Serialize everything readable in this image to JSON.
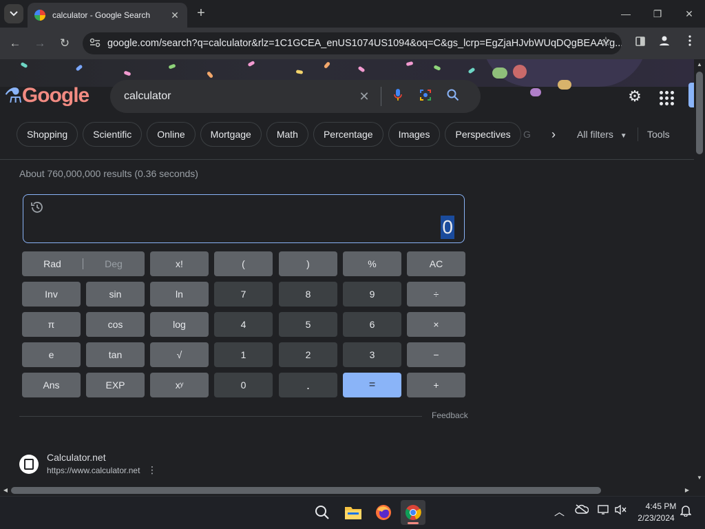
{
  "tab": {
    "title": "calculator - Google Search",
    "close": "✕"
  },
  "window": {
    "new_tab": "+",
    "minimize": "—",
    "restore": "❐",
    "close": "✕"
  },
  "toolbar": {
    "back": "←",
    "forward": "→",
    "reload": "↻",
    "url": "google.com/search?q=calculator&rlz=1C1GCEA_enUS1074US1094&oq=C&gs_lcrp=EgZjaHJvbWUqDQgBEAAYg...",
    "star": "☆"
  },
  "search": {
    "logo": "Google",
    "query": "calculator",
    "clear": "✕"
  },
  "chips": [
    "Shopping",
    "Scientific",
    "Online",
    "Mortgage",
    "Math",
    "Percentage",
    "Images",
    "Perspectives"
  ],
  "chip_overflow": "G",
  "filters": {
    "all_filters": "All filters",
    "tools": "Tools"
  },
  "stats": "About 760,000,000 results (0.36 seconds)",
  "calculator": {
    "display": "0",
    "rad": "Rad",
    "deg": "Deg",
    "keys": {
      "fact": "x!",
      "lparen": "(",
      "rparen": ")",
      "percent": "%",
      "ac": "AC",
      "inv": "Inv",
      "sin": "sin",
      "ln": "ln",
      "seven": "7",
      "eight": "8",
      "nine": "9",
      "divide": "÷",
      "pi": "π",
      "cos": "cos",
      "log": "log",
      "four": "4",
      "five": "5",
      "six": "6",
      "multiply": "×",
      "e": "e",
      "tan": "tan",
      "sqrt": "√",
      "one": "1",
      "two": "2",
      "three": "3",
      "minus": "−",
      "ans": "Ans",
      "exp": "EXP",
      "pow": "xʸ",
      "zero": "0",
      "dot": ".",
      "equals": "=",
      "plus": "+"
    },
    "feedback": "Feedback"
  },
  "result": {
    "site": "Calculator.net",
    "url": "https://www.calculator.net",
    "more": "⋮"
  },
  "taskbar": {
    "time": "4:45 PM",
    "date": "2/23/2024"
  },
  "colors": {
    "accent": "#8ab4f8",
    "background": "#202124",
    "function_key": "#5f6368",
    "number_key": "#3c4043"
  }
}
